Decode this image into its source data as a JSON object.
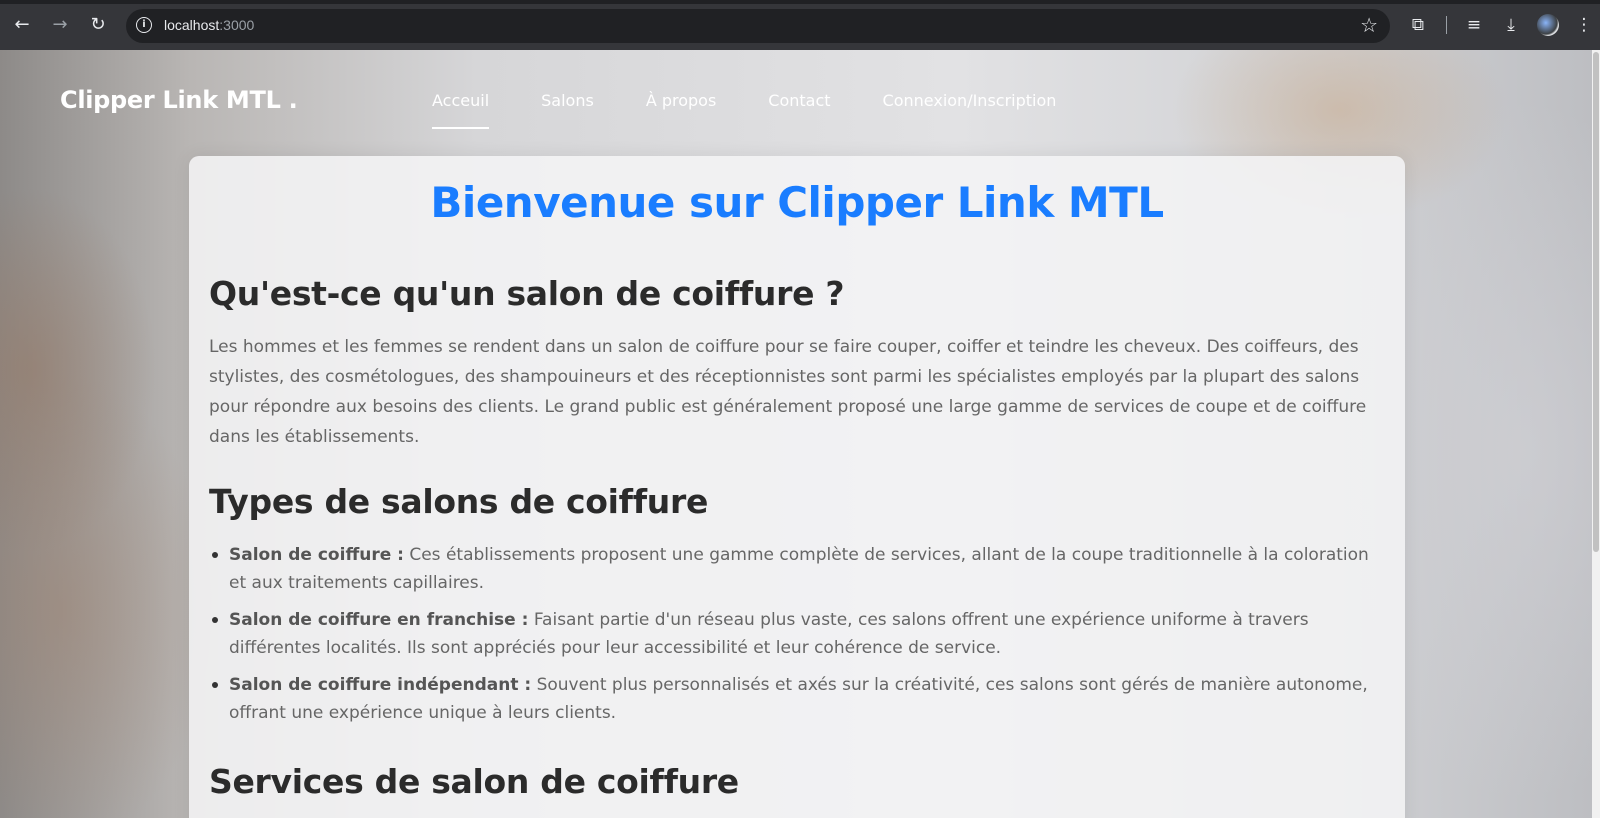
{
  "browser": {
    "url_host": "localhost",
    "url_port": ":3000"
  },
  "site": {
    "logo": "Clipper Link MTL .",
    "nav": [
      {
        "label": "Acceuil",
        "active": true
      },
      {
        "label": "Salons"
      },
      {
        "label": "À propos"
      },
      {
        "label": "Contact"
      },
      {
        "label": "Connexion/Inscription"
      }
    ]
  },
  "content": {
    "title": "Bienvenue sur Clipper Link MTL",
    "section1": {
      "heading": "Qu'est-ce qu'un salon de coiffure ?",
      "text": "Les hommes et les femmes se rendent dans un salon de coiffure pour se faire couper, coiffer et teindre les cheveux. Des coiffeurs, des stylistes, des cosmétologues, des shampouineurs et des réceptionnistes sont parmi les spécialistes employés par la plupart des salons pour répondre aux besoins des clients. Le grand public est généralement proposé une large gamme de services de coupe et de coiffure dans les établissements."
    },
    "section2": {
      "heading": "Types de salons de coiffure",
      "items": [
        {
          "term": "Salon de coiffure :",
          "desc": " Ces établissements proposent une gamme complète de services, allant de la coupe traditionnelle à la coloration et aux traitements capillaires."
        },
        {
          "term": "Salon de coiffure en franchise :",
          "desc": " Faisant partie d'un réseau plus vaste, ces salons offrent une expérience uniforme à travers différentes localités. Ils sont appréciés pour leur accessibilité et leur cohérence de service."
        },
        {
          "term": "Salon de coiffure indépendant :",
          "desc": " Souvent plus personnalisés et axés sur la créativité, ces salons sont gérés de manière autonome, offrant une expérience unique à leurs clients."
        }
      ]
    },
    "section3": {
      "heading": "Services de salon de coiffure"
    }
  }
}
